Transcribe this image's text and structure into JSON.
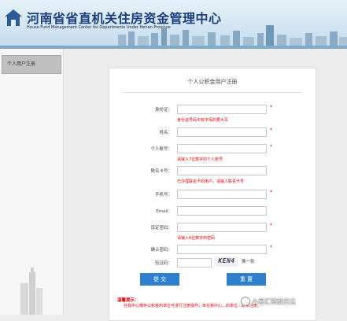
{
  "header": {
    "title": "河南省省直机关住房资金管理中心",
    "subtitle": "House Fund Management Center for Departments Under Henan Province"
  },
  "sidebar": {
    "items": [
      {
        "label": "个人用户注册"
      }
    ]
  },
  "form": {
    "title": "个人公积金用户注册",
    "id_card_label": "身份证：",
    "id_card_hint": "身份证号码中有字母的要大写",
    "name_label": "姓名：",
    "account_label": "个人账号：",
    "account_hint": "请输入7位数字的个人账号",
    "card_label": "联名卡号：",
    "card_hint": "已办理联名卡的用户，请输入联名卡号",
    "phone_label": "手机号：",
    "email_label": "Email：",
    "password_label": "设定密码：",
    "password_hint": "请输入6位数字的密码",
    "confirm_label": "确认密码：",
    "captcha_label": "验证码：",
    "captcha_text": "KEN4",
    "refresh_label": "换一张",
    "submit_label": "提 交",
    "reset_label": "重 置",
    "required_mark": "*"
  },
  "notice": {
    "title": "温馨提示：",
    "body": "在我中心缴存公积金的单位可进行注册操作；未在我中心…的单位…联系注册。"
  },
  "watermark": "小易汇特别关注",
  "colors": {
    "accent": "#2f7fcf",
    "warning": "#dd0000",
    "title": "#1a3f7a"
  }
}
